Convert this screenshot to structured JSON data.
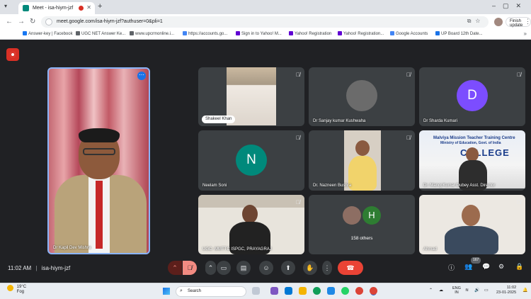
{
  "browser": {
    "tab_title": "Meet - isa-hiym-jzf",
    "url": "meet.google.com/isa-hiym-jzf?authuser=0&pli=1",
    "profile_button": "Finish update",
    "bookmarks": [
      {
        "label": "Answer-key | Facebook",
        "color": "#1877f2"
      },
      {
        "label": "UGC NET Answer Ke...",
        "color": "#5f6368"
      },
      {
        "label": "www.upcrmonline.i...",
        "color": "#5f6368"
      },
      {
        "label": "https://accounts.go...",
        "color": "#4285f4"
      },
      {
        "label": "Sign in to Yahoo! M...",
        "color": "#6001d2"
      },
      {
        "label": "Yahoo! Registration",
        "color": "#6001d2"
      },
      {
        "label": "Yahoo! Registration...",
        "color": "#6001d2"
      },
      {
        "label": "Google Accounts",
        "color": "#4285f4"
      },
      {
        "label": "UP Board 12th Date...",
        "color": "#1a73e8"
      }
    ]
  },
  "meet": {
    "time": "11:02 AM",
    "separator": "|",
    "meeting_code": "isa-hiym-jzf",
    "participant_count": "167",
    "main_speaker": "Dr Kapil Dev Mishra",
    "tiles": [
      {
        "name": "Shakeel Khan",
        "kind": "video-room"
      },
      {
        "name": "Dr Sanjay kumar Kushwaha",
        "kind": "avatar-photo"
      },
      {
        "name": "Dr Sharda Kumari",
        "kind": "avatar",
        "initial": "D",
        "color": "#7c4dff"
      },
      {
        "name": "Neelam Soni",
        "kind": "avatar",
        "initial": "N",
        "color": "#00897b"
      },
      {
        "name": "Dr. Nazneen Bushra",
        "kind": "video-lady"
      },
      {
        "name": "Dr. Manoj Kumar Dubey Asst. Director",
        "kind": "video-banner"
      },
      {
        "name": "UGC- MMTTC ISPGC, PRAYAGRAJ",
        "kind": "video-hall"
      },
      {
        "name": "158 others",
        "kind": "others",
        "initial": "H",
        "color": "#2e7d32"
      },
      {
        "name": "Ahmad",
        "kind": "video-man"
      }
    ],
    "banner_line": "Malviya Mission Teacher Training Centre",
    "banner_sub": "Ministry of Education, Govt. of India",
    "banner_big": "COLLEGE"
  },
  "taskbar": {
    "weather_temp": "19°C",
    "weather_text": "Fog",
    "search_placeholder": "Search",
    "lang": "ENG",
    "lang2": "IN",
    "clock_time": "11:02",
    "clock_date": "23-01-2025"
  }
}
